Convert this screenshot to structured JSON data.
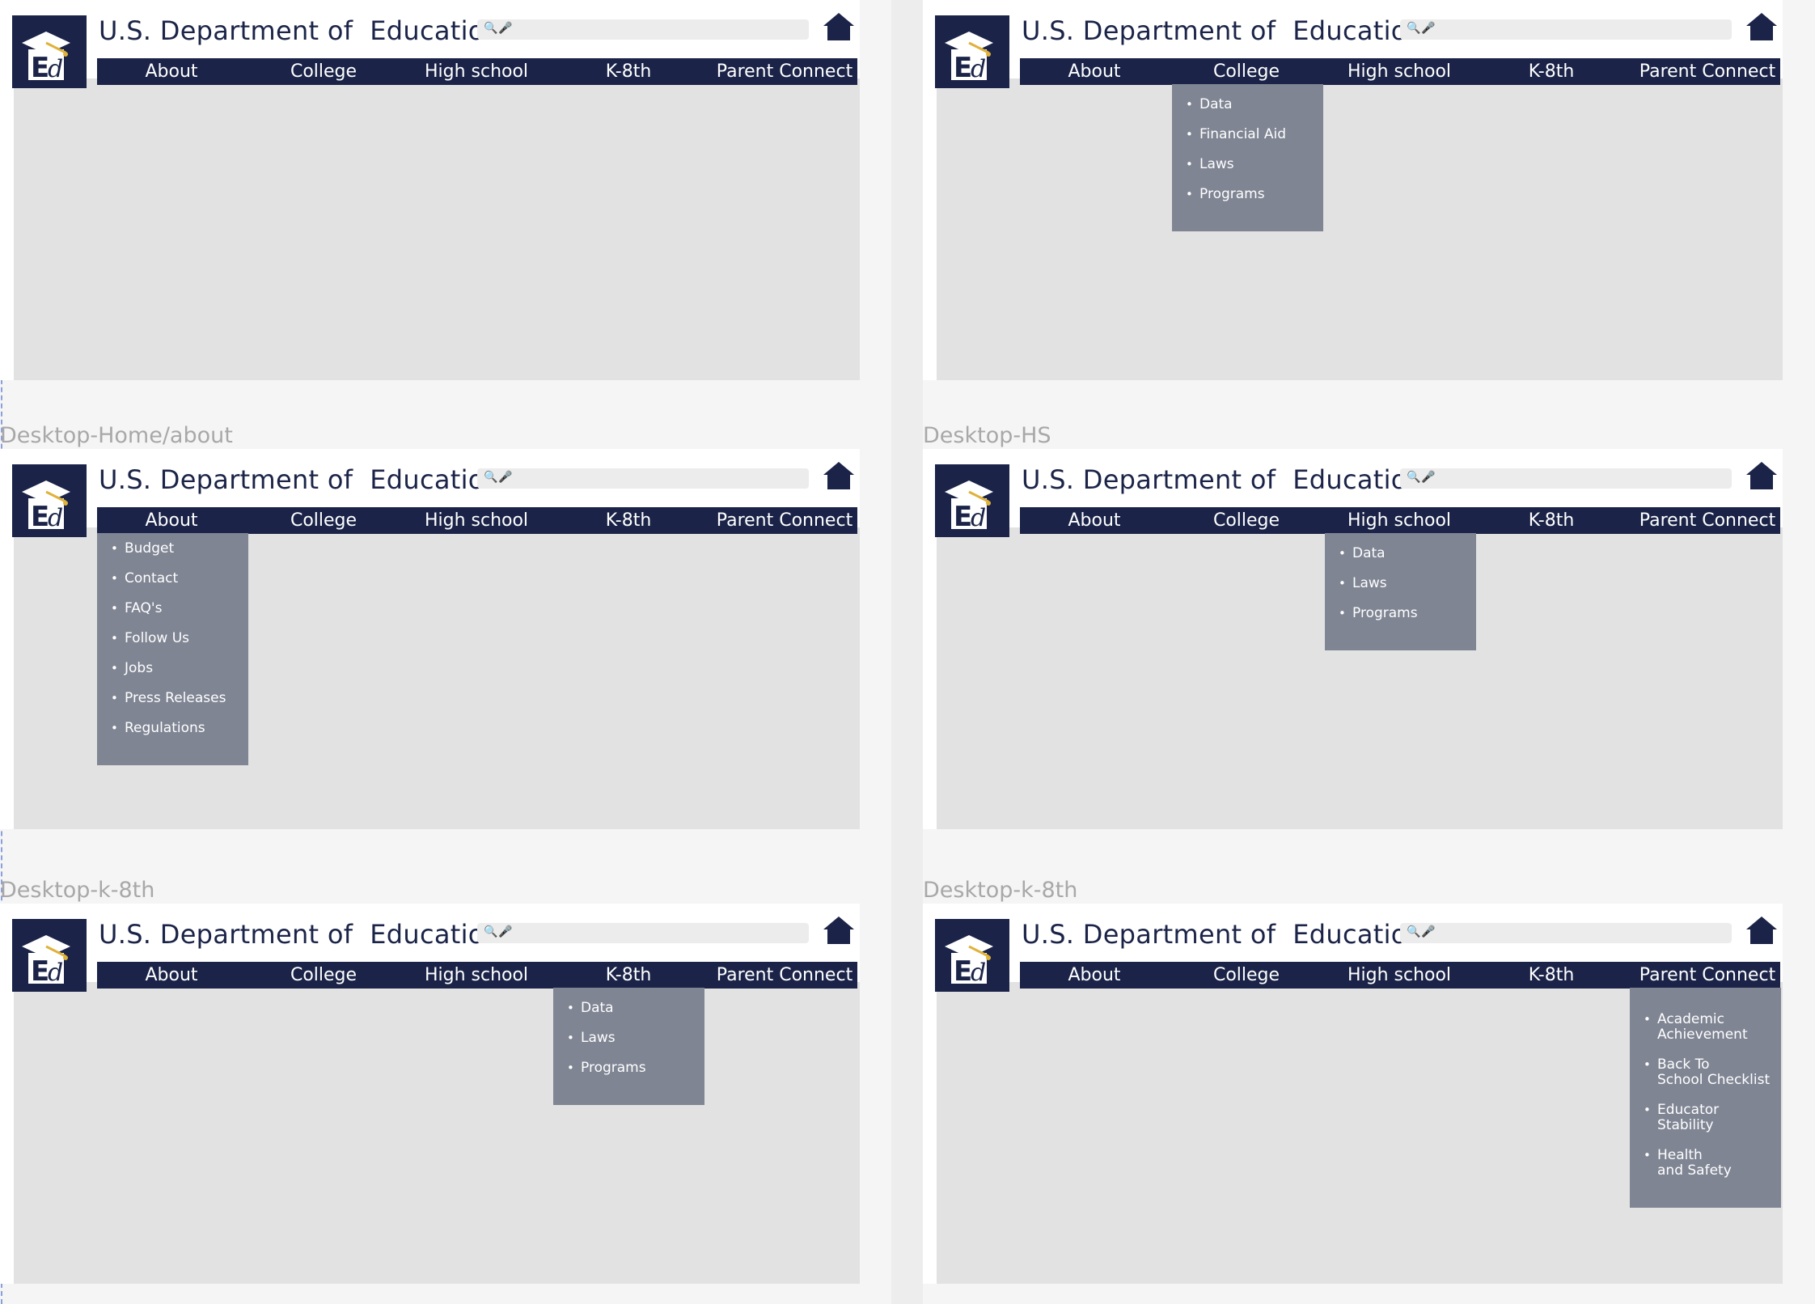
{
  "site": {
    "title": "U.S. Department of  Education",
    "search_icon": "🔍",
    "mic_icon": "🎤",
    "brand_color": "#1b2448",
    "dropdown_color": "#7f8593"
  },
  "nav_items": [
    "About",
    "College",
    "High school",
    "K-8th",
    "Parent Connect"
  ],
  "frame_labels": [
    "Desktop-Home/about",
    "Desktop-HS",
    "Desktop-k-8th",
    "Desktop-k-8th"
  ],
  "frames": [
    {
      "active": null,
      "dropdown_items": []
    },
    {
      "active": 1,
      "dropdown_items": [
        "Data",
        "Financial Aid",
        "Laws",
        "Programs"
      ]
    },
    {
      "active": 0,
      "dropdown_items": [
        "Budget",
        "Contact",
        "FAQ's",
        "Follow Us",
        "Jobs",
        "Press Releases",
        "Regulations"
      ]
    },
    {
      "active": 2,
      "dropdown_items": [
        "Data",
        "Laws",
        "Programs"
      ]
    },
    {
      "active": 3,
      "dropdown_items": [
        "Data",
        "Laws",
        "Programs"
      ]
    },
    {
      "active": 4,
      "dropdown_items": [
        "Academic\nAchievement",
        "Back To\nSchool Checklist",
        "Educator\nStability",
        "Health\nand Safety"
      ]
    }
  ]
}
